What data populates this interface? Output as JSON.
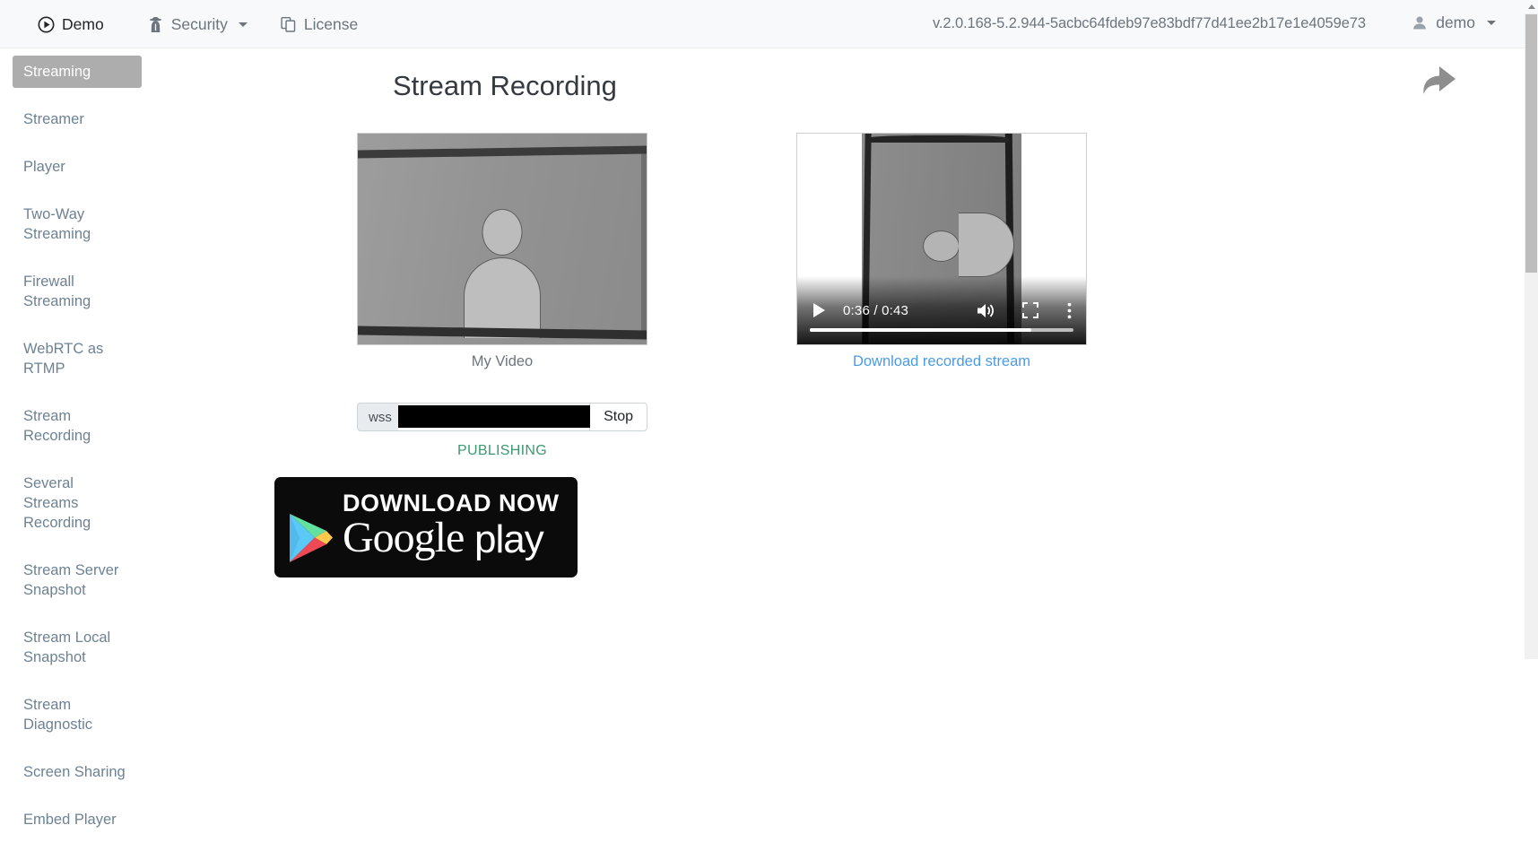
{
  "navbar": {
    "brand": {
      "label": "Demo",
      "icon": "play-circle-icon"
    },
    "items": [
      {
        "label": "Security",
        "icon": "user-secret-icon",
        "has_caret": true
      },
      {
        "label": "License",
        "icon": "copy-documents-icon",
        "has_caret": false
      }
    ],
    "version": "v.2.0.168-5.2.944-5acbc64fdeb97e83bdf77d41ee2b17e1e4059e73",
    "user": {
      "label": "demo",
      "icon": "user-icon",
      "has_caret": true
    }
  },
  "sidebar": {
    "items": [
      {
        "label": "Streaming",
        "active": true
      },
      {
        "label": "Streamer",
        "active": false
      },
      {
        "label": "Player",
        "active": false
      },
      {
        "label": "Two-Way Streaming",
        "active": false
      },
      {
        "label": "Firewall Streaming",
        "active": false
      },
      {
        "label": "WebRTC as RTMP",
        "active": false
      },
      {
        "label": "Stream Recording",
        "active": false
      },
      {
        "label": "Several Streams Recording",
        "active": false
      },
      {
        "label": "Stream Server Snapshot",
        "active": false
      },
      {
        "label": "Stream Local Snapshot",
        "active": false
      },
      {
        "label": "Stream Diagnostic",
        "active": false
      },
      {
        "label": "Screen Sharing",
        "active": false
      },
      {
        "label": "Embed Player",
        "active": false
      }
    ]
  },
  "main": {
    "title": "Stream Recording",
    "share_icon": "share-arrow-icon",
    "local_video": {
      "caption": "My Video"
    },
    "recorded_video": {
      "download_link": "Download recorded stream",
      "current_time": "0:36",
      "duration": "0:43",
      "time_display": "0:36 / 0:43",
      "progress_percent": 84,
      "controls": [
        "play-icon",
        "volume-icon",
        "fullscreen-icon",
        "overflow-menu-icon"
      ]
    },
    "stream_input": {
      "prefix": "wss",
      "value": "",
      "placeholder": "",
      "redacted": true,
      "button_label": "Stop"
    },
    "status": {
      "text": "PUBLISHING",
      "color": "#3d9970"
    },
    "google_play_badge": {
      "line1": "DOWNLOAD NOW",
      "line2_a": "Google",
      "line2_b": "play"
    }
  },
  "colors": {
    "navbar_bg": "#f8f9fa",
    "sidebar_active_bg": "#adadad",
    "sidebar_text": "#6d8293",
    "link": "#4a9be5",
    "status_green": "#3d9970",
    "muted": "#6c757d"
  }
}
